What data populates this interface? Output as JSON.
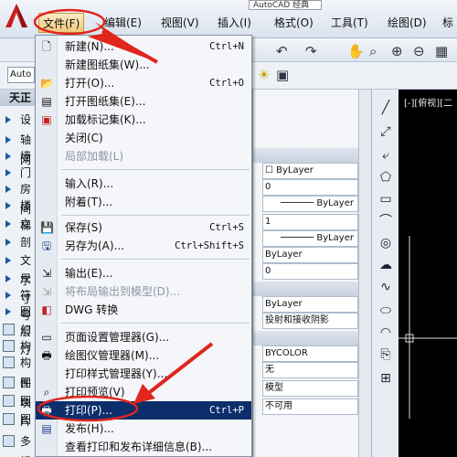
{
  "topbar": {
    "autocad_label": "AutoCAD 经典"
  },
  "menubar": {
    "items": [
      "文件(F)",
      "编辑(E)",
      "视图(V)",
      "插入(I)",
      "格式(O)",
      "工具(T)",
      "绘图(D)",
      "标"
    ]
  },
  "left_toolbar": {
    "field_text": "Auto"
  },
  "palette": {
    "title": "天正",
    "items": [
      "设",
      "轴网",
      "墙",
      "门",
      "房间",
      "楼梯",
      "立",
      "剖",
      "文字",
      "尺寸",
      "符号",
      "图层",
      "幻灯",
      "构",
      "构件",
      "图块",
      "图片",
      "图",
      "多视"
    ]
  },
  "props": {
    "cells": [
      "ByLayer",
      "0",
      "ByLayer",
      "1",
      "ByLayer",
      "ByLayer",
      "0",
      "ByLayer",
      "投射和接收阴影",
      "BYCOLOR",
      "无",
      "模型",
      "不可用"
    ]
  },
  "canvas": {
    "view_label": "[-][俯视][二"
  },
  "file_menu": {
    "items": [
      {
        "label": "新建(N)...",
        "shortcut": "Ctrl+N",
        "icon": "new-icon",
        "disabled": false
      },
      {
        "label": "新建图纸集(W)...",
        "shortcut": "",
        "icon": "",
        "disabled": false
      },
      {
        "label": "打开(O)...",
        "shortcut": "Ctrl+O",
        "icon": "open-icon",
        "disabled": false
      },
      {
        "label": "打开图纸集(E)...",
        "shortcut": "",
        "icon": "open-sheetset-icon",
        "disabled": false
      },
      {
        "label": "加载标记集(K)...",
        "shortcut": "",
        "icon": "markup-icon",
        "disabled": false
      },
      {
        "label": "关闭(C)",
        "shortcut": "",
        "icon": "",
        "disabled": false
      },
      {
        "label": "局部加载(L)",
        "shortcut": "",
        "icon": "",
        "disabled": true
      },
      {
        "label": "输入(R)...",
        "shortcut": "",
        "icon": "",
        "disabled": false
      },
      {
        "label": "附着(T)...",
        "shortcut": "",
        "icon": "",
        "disabled": false
      },
      {
        "label": "保存(S)",
        "shortcut": "Ctrl+S",
        "icon": "save-icon",
        "disabled": false
      },
      {
        "label": "另存为(A)...",
        "shortcut": "Ctrl+Shift+S",
        "icon": "save-as-icon",
        "disabled": false
      },
      {
        "label": "输出(E)...",
        "shortcut": "",
        "icon": "export-icon",
        "disabled": false
      },
      {
        "label": "将布局输出到模型(D)...",
        "shortcut": "",
        "icon": "layout-export-icon",
        "disabled": true
      },
      {
        "label": "DWG 转换",
        "shortcut": "",
        "icon": "dwg-convert-icon",
        "disabled": false
      },
      {
        "label": "页面设置管理器(G)...",
        "shortcut": "",
        "icon": "page-setup-icon",
        "disabled": false
      },
      {
        "label": "绘图仪管理器(M)...",
        "shortcut": "",
        "icon": "plotter-icon",
        "disabled": false
      },
      {
        "label": "打印样式管理器(Y)...",
        "shortcut": "",
        "icon": "",
        "disabled": false
      },
      {
        "label": "打印预览(V)",
        "shortcut": "",
        "icon": "preview-icon",
        "disabled": false
      },
      {
        "label": "打印(P)...",
        "shortcut": "Ctrl+P",
        "icon": "print-icon",
        "disabled": false,
        "highlight": true
      },
      {
        "label": "发布(H)...",
        "shortcut": "",
        "icon": "publish-icon",
        "disabled": false
      },
      {
        "label": "查看打印和发布详细信息(B)...",
        "shortcut": "",
        "icon": "",
        "disabled": false
      }
    ]
  },
  "colors": {
    "annotation_red": "#e0261e",
    "highlight_bg": "#0c2f6c"
  }
}
